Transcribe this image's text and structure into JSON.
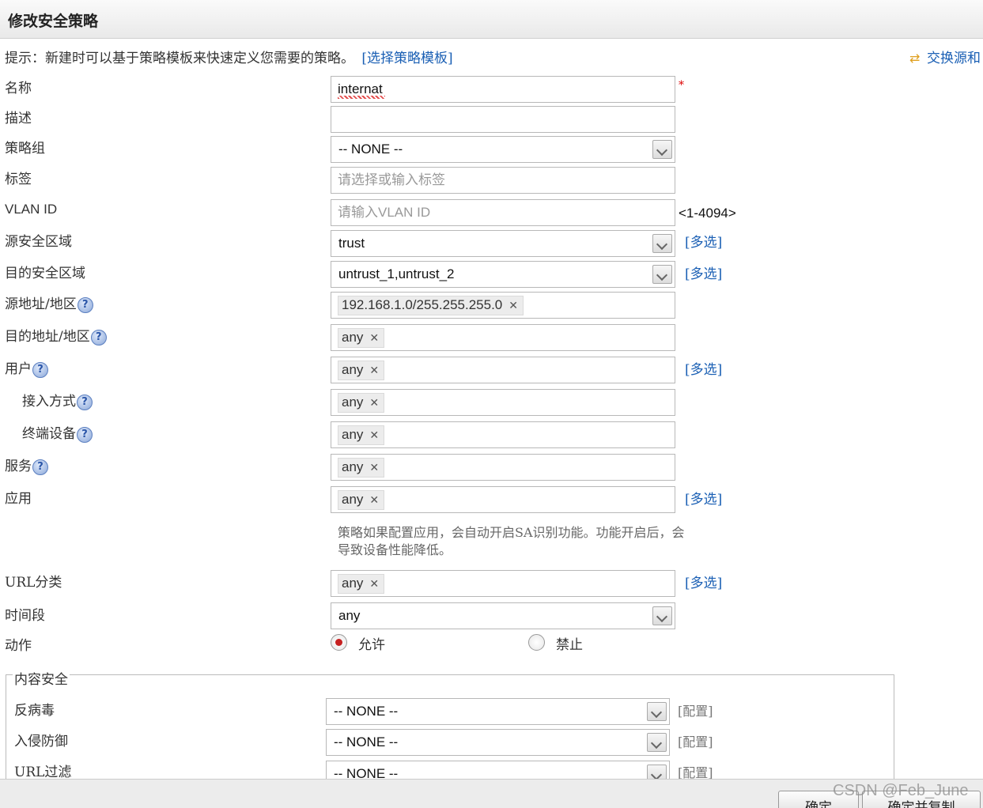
{
  "dialog": {
    "title": "修改安全策略"
  },
  "hint": {
    "text": "提示：新建时可以基于策略模板来快速定义您需要的策略。",
    "link": "[选择策略模板]"
  },
  "swap_link": "交换源和",
  "form": {
    "name": {
      "label": "名称",
      "value": "internat",
      "required_mark": "*"
    },
    "description": {
      "label": "描述",
      "value": ""
    },
    "policy_group": {
      "label": "策略组",
      "value": "-- NONE --"
    },
    "tag": {
      "label": "标签",
      "placeholder": "请选择或输入标签"
    },
    "vlan_id": {
      "label": "VLAN ID",
      "placeholder": "请输入VLAN ID",
      "range": "<1-4094>"
    },
    "source_zone": {
      "label": "源安全区域",
      "value": "trust"
    },
    "dest_zone": {
      "label": "目的安全区域",
      "value": "untrust_1,untrust_2"
    },
    "source_address": {
      "label": "源地址/地区",
      "tag": "192.168.1.0/255.255.255.0"
    },
    "dest_address": {
      "label": "目的地址/地区",
      "tag": "any"
    },
    "user": {
      "label": "用户",
      "tag": "any"
    },
    "access_mode": {
      "label": "接入方式",
      "tag": "any"
    },
    "terminal_device": {
      "label": "终端设备",
      "tag": "any"
    },
    "service": {
      "label": "服务",
      "tag": "any"
    },
    "application": {
      "label": "应用",
      "tag": "any"
    },
    "application_note": "策略如果配置应用，会自动开启SA识别功能。功能开启后，会导致设备性能降低。",
    "url_category": {
      "label": "URL分类",
      "tag": "any"
    },
    "time_range": {
      "label": "时间段",
      "value": "any"
    },
    "action": {
      "label": "动作",
      "allow": "允许",
      "deny": "禁止",
      "selected": "allow"
    },
    "multi_select": "[多选]",
    "help_icon": "?"
  },
  "content_security": {
    "legend": "内容安全",
    "antivirus": {
      "label": "反病毒",
      "value": "-- NONE --",
      "config": "[配置]"
    },
    "ips": {
      "label": "入侵防御",
      "value": "-- NONE --",
      "config": "[配置]"
    },
    "url_filter": {
      "label": "URL过滤",
      "value": "-- NONE --",
      "config": "[配置]"
    }
  },
  "buttons": {
    "ok": "确定",
    "ok_copy": "确定并复制"
  },
  "watermark": "CSDN @Feb_June",
  "colors": {
    "link": "#1a5fb4",
    "required": "#dd0000",
    "radio_selected": "#c62020"
  }
}
